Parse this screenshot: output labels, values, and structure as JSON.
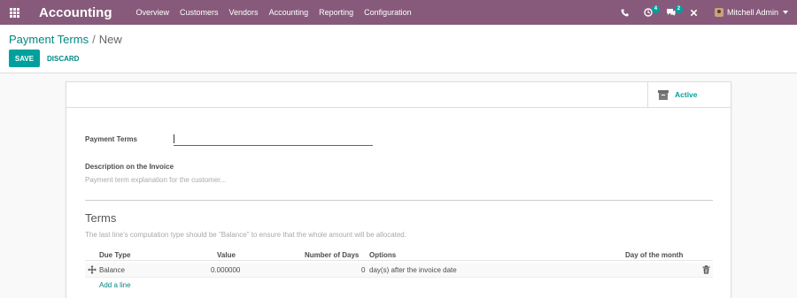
{
  "navbar": {
    "brand": "Accounting",
    "menu": [
      "Overview",
      "Customers",
      "Vendors",
      "Accounting",
      "Reporting",
      "Configuration"
    ],
    "activities_badge": "4",
    "messages_badge": "2",
    "user_name": "Mitchell Admin"
  },
  "breadcrumb": {
    "parent": "Payment Terms",
    "separator": "/",
    "current": "New"
  },
  "actions": {
    "save": "SAVE",
    "discard": "DISCARD"
  },
  "form": {
    "active_label": "Active",
    "payment_terms_label": "Payment Terms",
    "payment_terms_value": "",
    "description_label": "Description on the Invoice",
    "description_placeholder": "Payment term explanation for the customer...",
    "terms_title": "Terms",
    "terms_help": "The last line's computation type should be \"Balance\" to ensure that the whole amount will be allocated.",
    "columns": {
      "due_type": "Due Type",
      "value": "Value",
      "number_of_days": "Number of Days",
      "options": "Options",
      "day_of_month": "Day of the month"
    },
    "rows": [
      {
        "due_type": "Balance",
        "value": "0.000000",
        "number_of_days": "0",
        "options": "day(s) after the invoice date",
        "day_of_month": ""
      }
    ],
    "add_line": "Add a line"
  },
  "colors": {
    "navbar": "#875a7b",
    "primary": "#00a09d",
    "link": "#008784"
  },
  "icons": [
    "apps-grid-icon",
    "phone-icon",
    "activities-icon",
    "messages-icon",
    "debug-close-icon",
    "archive-icon",
    "drag-handle-icon",
    "trash-icon"
  ]
}
